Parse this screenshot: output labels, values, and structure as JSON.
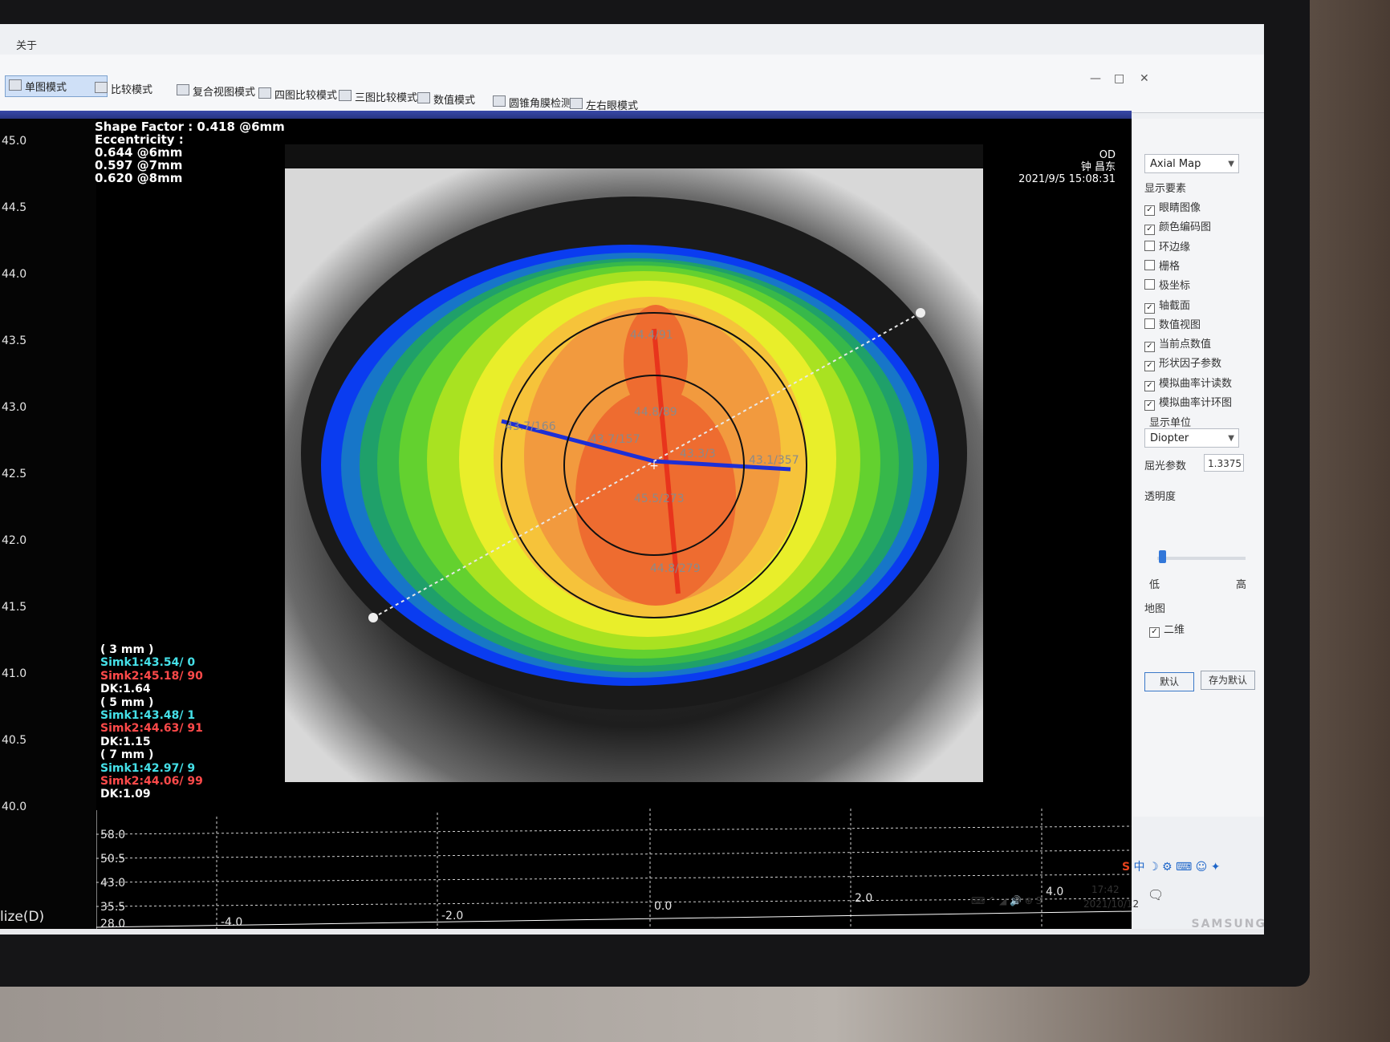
{
  "menu": {
    "about": "关于"
  },
  "toolbar": {
    "single": "单图模式",
    "compare": "比较模式",
    "composite": "复合视图模式",
    "four": "四图比较模式",
    "three": "三图比较模式",
    "numeric": "数值模式",
    "cone": "圆锥角膜检测",
    "lr": "左右眼模式"
  },
  "info": {
    "shape_factor": "Shape Factor : 0.418 @6mm",
    "eccentricity": "Eccentricity :",
    "ecc6": "0.644 @6mm",
    "ecc7": "0.597 @7mm",
    "ecc8": "0.620 @8mm"
  },
  "scale": {
    "ticks": [
      "45.0",
      "44.5",
      "44.0",
      "43.5",
      "43.0",
      "42.5",
      "42.0",
      "41.5",
      "41.0",
      "40.5",
      "40.0"
    ],
    "label": "lize(D)"
  },
  "sim": {
    "z3": "( 3 mm )",
    "k1_3": "Simk1:43.54/  0",
    "k2_3": "Simk2:45.18/ 90",
    "dk3": "DK:1.64",
    "z5": "( 5 mm )",
    "k1_5": "Simk1:43.48/  1",
    "k2_5": "Simk2:44.63/ 91",
    "dk5": "DK:1.15",
    "z7": "( 7 mm )",
    "k1_7": "Simk1:42.97/  9",
    "k2_7": "Simk2:44.06/ 99",
    "dk7": "DK:1.09"
  },
  "patient": {
    "eye": "OD",
    "name": "钟 昌东",
    "datetime": "2021/9/5 15:08:31"
  },
  "map_labels": {
    "top": "44.4/91",
    "inner_top": "44.8/89",
    "outer_left": "43.7/166",
    "inner_left": "43.7/157",
    "inner_right": "43.3/3",
    "outer_right": "43.1/357",
    "inner_bottom": "45.5/273",
    "outer_bottom": "44.8/279"
  },
  "profile": {
    "y_ticks": [
      "58.0",
      "50.5",
      "43.0",
      "35.5",
      "28.0"
    ],
    "x_ticks": [
      "-4.0",
      "-2.0",
      "0.0",
      "2.0",
      "4.0"
    ]
  },
  "side": {
    "map_type": "Axial Map",
    "display_elements": "显示要素",
    "options": [
      {
        "label": "眼睛图像",
        "checked": true
      },
      {
        "label": "颜色编码图",
        "checked": true
      },
      {
        "label": "环边缘",
        "checked": false
      },
      {
        "label": "栅格",
        "checked": false
      },
      {
        "label": "极坐标",
        "checked": false
      },
      {
        "label": "轴截面",
        "checked": true
      },
      {
        "label": "数值视图",
        "checked": false
      },
      {
        "label": "当前点数值",
        "checked": true
      },
      {
        "label": "形状因子参数",
        "checked": true
      },
      {
        "label": "模拟曲率计读数",
        "checked": true
      },
      {
        "label": "模拟曲率计环图",
        "checked": true
      }
    ],
    "unit_label": "显示单位",
    "unit": "Diopter",
    "refraction_label": "屈光参数",
    "refraction": "1.3375",
    "transparency_label": "透明度",
    "transparency": 0.05,
    "low": "低",
    "high": "高",
    "map_label": "地图",
    "twod": "二维",
    "twod_checked": true,
    "default_btn": "默认",
    "save_default_btn": "存为默认"
  },
  "tray": {
    "time": "17:42",
    "date": "2021/10/12",
    "ime": "中"
  },
  "brand": "SAMSUNG"
}
